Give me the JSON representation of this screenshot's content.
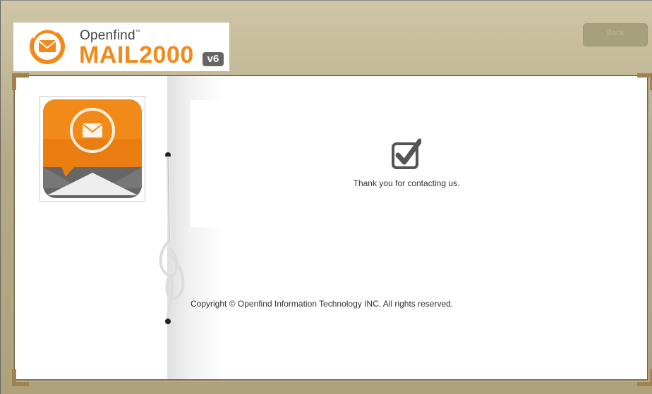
{
  "header": {
    "brand_small": "Openfind",
    "brand_tm": "™",
    "brand_big": "MAIL2000",
    "brand_version": "v6",
    "top_button_label": "Back"
  },
  "main": {
    "confirmation_message": "Thank you for contacting us.",
    "copyright": "Copyright © Openfind Information Technology INC. All rights reserved."
  },
  "icons": {
    "logo": "mail-envelope-orange-circle-icon",
    "app": "mail-app-icon",
    "status": "checkbox-checked-icon"
  },
  "colors": {
    "brand_orange": "#f28a1a",
    "frame_tan": "#b8ad89",
    "text_dark": "#333333"
  }
}
